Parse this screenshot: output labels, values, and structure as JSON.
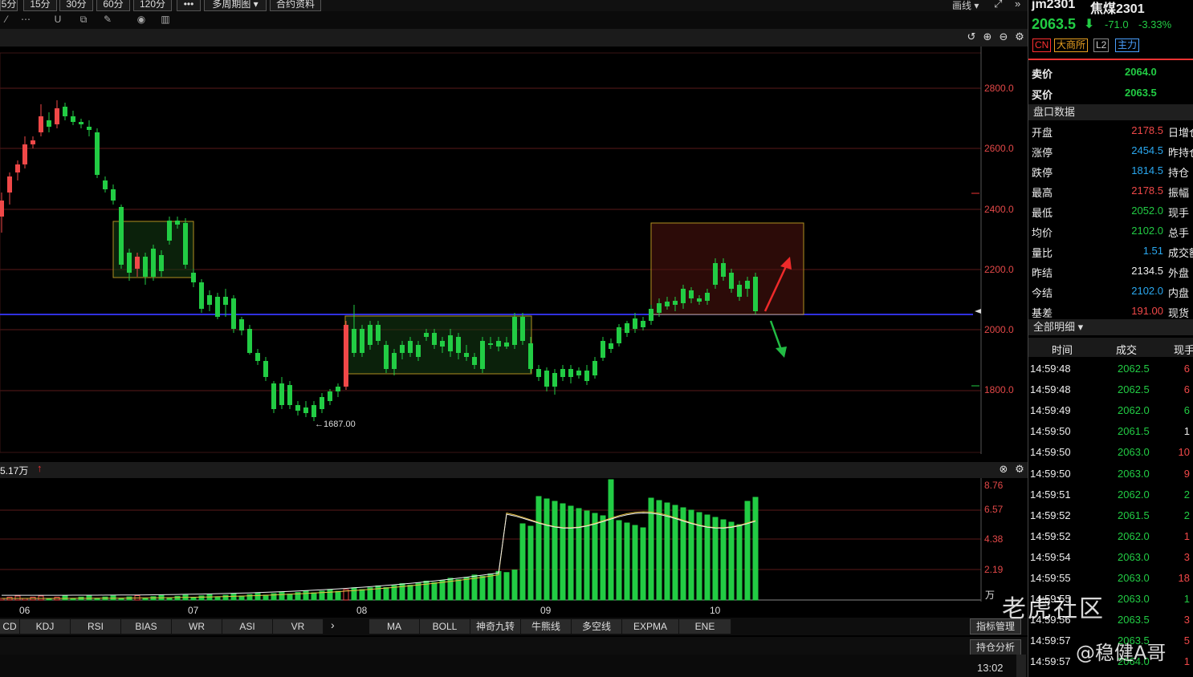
{
  "toolbar": {
    "periods": [
      "5分",
      "15分",
      "30分",
      "60分",
      "120分",
      "•••",
      "多周期图 ▾",
      "合约资料"
    ],
    "right_label": "画线 ▾"
  },
  "instrument": {
    "code": "jm2301",
    "name": "焦煤2301",
    "price": "2063.5",
    "change": "-71.0",
    "change_pct": "-3.33%",
    "badges": [
      "CN",
      "大商所",
      "L2",
      "主力"
    ]
  },
  "quote": {
    "sell_label": "卖价",
    "sell_value": "2064.0",
    "buy_label": "买价",
    "buy_value": "2063.5"
  },
  "panel_title": "盘口数据",
  "panel_rows": [
    {
      "label": "开盘",
      "value": "2178.5",
      "color": "red",
      "extra": "日增仓"
    },
    {
      "label": "涨停",
      "value": "2454.5",
      "color": "cyan",
      "extra": "昨持仓"
    },
    {
      "label": "跌停",
      "value": "1814.5",
      "color": "cyan",
      "extra": "持仓"
    },
    {
      "label": "最高",
      "value": "2178.5",
      "color": "red",
      "extra": "振幅"
    },
    {
      "label": "最低",
      "value": "2052.0",
      "color": "green",
      "extra": "现手"
    },
    {
      "label": "均价",
      "value": "2102.0",
      "color": "green",
      "extra": "总手"
    },
    {
      "label": "量比",
      "value": "1.51",
      "color": "cyan",
      "extra": "成交额"
    },
    {
      "label": "昨结",
      "value": "2134.5",
      "color": "white",
      "extra": "外盘"
    },
    {
      "label": "今结",
      "value": "2102.0",
      "color": "cyan",
      "extra": "内盘"
    },
    {
      "label": "基差",
      "value": "191.00",
      "color": "red",
      "extra": "现货"
    }
  ],
  "detail_title": "全部明细 ▾",
  "detail_headers": [
    "时间",
    "成交",
    "现手"
  ],
  "detail_rows": [
    {
      "time": "14:59:48",
      "price": "2062.5",
      "qty": "6",
      "qcolor": "red"
    },
    {
      "time": "14:59:48",
      "price": "2062.5",
      "qty": "6",
      "qcolor": "red"
    },
    {
      "time": "14:59:49",
      "price": "2062.0",
      "qty": "6",
      "qcolor": "green"
    },
    {
      "time": "14:59:50",
      "price": "2061.5",
      "qty": "1",
      "qcolor": "white"
    },
    {
      "time": "14:59:50",
      "price": "2063.0",
      "qty": "10",
      "qcolor": "red"
    },
    {
      "time": "14:59:50",
      "price": "2063.0",
      "qty": "9",
      "qcolor": "red"
    },
    {
      "time": "14:59:51",
      "price": "2062.0",
      "qty": "2",
      "qcolor": "green"
    },
    {
      "time": "14:59:52",
      "price": "2061.5",
      "qty": "2",
      "qcolor": "green"
    },
    {
      "time": "14:59:52",
      "price": "2062.0",
      "qty": "1",
      "qcolor": "red"
    },
    {
      "time": "14:59:54",
      "price": "2063.0",
      "qty": "3",
      "qcolor": "red"
    },
    {
      "time": "14:59:55",
      "price": "2063.0",
      "qty": "18",
      "qcolor": "red"
    },
    {
      "time": "14:59:55",
      "price": "2063.0",
      "qty": "1",
      "qcolor": "green"
    },
    {
      "time": "14:59:56",
      "price": "2063.5",
      "qty": "3",
      "qcolor": "red"
    },
    {
      "time": "14:59:57",
      "price": "2063.5",
      "qty": "5",
      "qcolor": "red"
    },
    {
      "time": "14:59:57",
      "price": "2064.0",
      "qty": "1",
      "qcolor": "red"
    }
  ],
  "price_axis": {
    "ticks": [
      "2800.0",
      "2600.0",
      "2400.0",
      "2200.0",
      "2000.0",
      "1800.0"
    ]
  },
  "low_annotation": "←1687.00",
  "volume": {
    "label": "5.17万",
    "ticks": [
      "8.76",
      "6.57",
      "4.38",
      "2.19"
    ],
    "unit": "万"
  },
  "time_axis": [
    "06",
    "07",
    "08",
    "09",
    "10"
  ],
  "indicator_tabs_left": [
    "CD",
    "KDJ",
    "RSI",
    "BIAS",
    "WR",
    "ASI",
    "VR"
  ],
  "indicator_tabs_right": [
    "MA",
    "BOLL",
    "神奇九转",
    "牛熊线",
    "多空线",
    "EXPMA",
    "ENE"
  ],
  "buttons": {
    "indicator_manage": "指标管理",
    "position_analysis": "持仓分析"
  },
  "clock": "13:02",
  "watermark": {
    "line1": "老虎社区",
    "line2": "@稳健A哥"
  },
  "colors": {
    "up": "#f04848",
    "down": "#22cc44",
    "support_line": "#3030e0",
    "box_border": "#b09020"
  }
}
